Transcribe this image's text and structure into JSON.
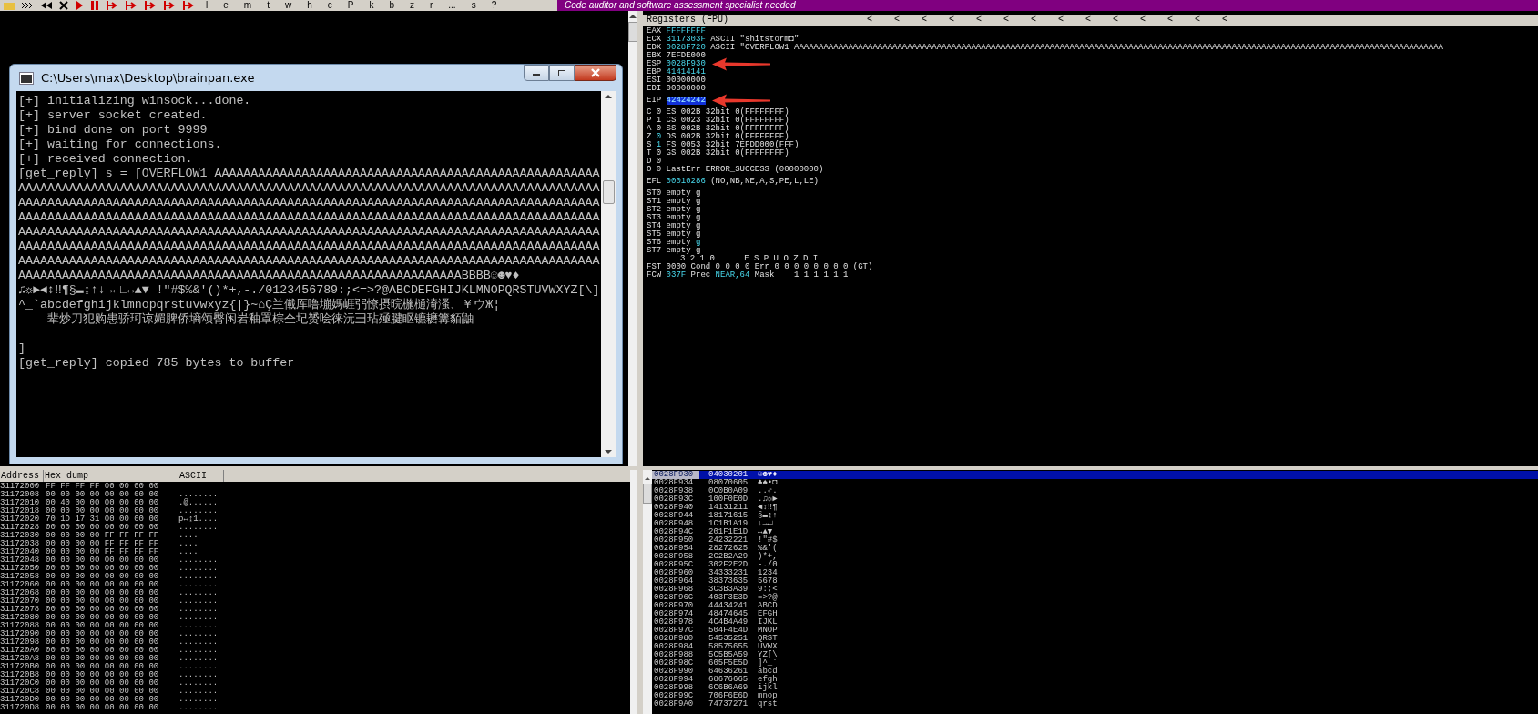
{
  "toolbar": {
    "letters": [
      "l",
      "e",
      "m",
      "t",
      "w",
      "h",
      "c",
      "P",
      "k",
      "b",
      "z",
      "r",
      "...",
      "s",
      "?"
    ],
    "banner": "Code auditor and software assessment specialist needed"
  },
  "console": {
    "title": "C:\\Users\\max\\Desktop\\brainpan.exe",
    "output": [
      [
        "[+] initializing winsock...done.",
        "[+] server socket created.",
        "[+] bind done on port 9999",
        "[+] waiting for connections.",
        "[+] received connection.",
        "[get_reply] s = [OVERFLOW1 AAAAAAAAAAAAAAAAAAAAAAAAAAAAAAAAAAAAAAAAAAAAAAAAAAAAA",
        "AAAAAAAAAAAAAAAAAAAAAAAAAAAAAAAAAAAAAAAAAAAAAAAAAAAAAAAAAAAAAAAAAAAAAAAAAAAAAAAA",
        "AAAAAAAAAAAAAAAAAAAAAAAAAAAAAAAAAAAAAAAAAAAAAAAAAAAAAAAAAAAAAAAAAAAAAAAAAAAAAAAA",
        "AAAAAAAAAAAAAAAAAAAAAAAAAAAAAAAAAAAAAAAAAAAAAAAAAAAAAAAAAAAAAAAAAAAAAAAAAAAAAAAA",
        "AAAAAAAAAAAAAAAAAAAAAAAAAAAAAAAAAAAAAAAAAAAAAAAAAAAAAAAAAAAAAAAAAAAAAAAAAAAAAAAA",
        "AAAAAAAAAAAAAAAAAAAAAAAAAAAAAAAAAAAAAAAAAAAAAAAAAAAAAAAAAAAAAAAAAAAAAAAAAAAAAAAA",
        "AAAAAAAAAAAAAAAAAAAAAAAAAAAAAAAAAAAAAAAAAAAAAAAAAAAAAAAAAAAAAAAAAAAAAAAAAAAAAAAA",
        "AAAAAAAAAAAAAAAAAAAAAAAAAAAAAAAAAAAAAAAAAAAAAAAAAAAAAAAAAAAAABBBB☺☻♥♦",
        "♫☼►◄↕‼¶§▬↨↑↓→←∟↔▲▼ !\"#$%&'()*+,-./0123456789:;<=>?@ABCDEFGHIJKLMNOPQRSTUVWXYZ[\\]",
        "^_`abcdefghijklmnopqrstuvwxyz{|}~⌂Ç兰儎厍噜塴媽崕弜憭摂晥椸樋渏溞、￥ウЖ¦",
        "    辈炒刀犯购患骄珂谅媚脾侨墒颂臀闲岩釉罩棕仝圮赟哙徕沅彐玷殛腱眍镳耱篝貊鼬"
      ],
      [
        "]",
        "[get_reply] copied 785 bytes to buffer"
      ]
    ]
  },
  "registers": {
    "title": "Registers (FPU)",
    "scroll_arrows": [
      "<",
      "<",
      "<",
      "<",
      "<",
      "<",
      "<",
      "<",
      "<",
      "<",
      "<",
      "<",
      "<",
      "<"
    ],
    "lines": [
      {
        "kind": "line",
        "arrow": false,
        "cells": [
          {
            "text": "EAX",
            "kind": "label"
          },
          {
            "text": "FFFFFFFF",
            "kind": "changed"
          }
        ]
      },
      {
        "kind": "line",
        "arrow": false,
        "cells": [
          {
            "text": "ECX",
            "kind": "label"
          },
          {
            "text": "3117303F",
            "kind": "changed"
          },
          {
            "text": "ASCII \"shitstorm◘\"",
            "kind": "label"
          }
        ]
      },
      {
        "kind": "line",
        "arrow": false,
        "cells": [
          {
            "text": "EDX",
            "kind": "label"
          },
          {
            "text": "0028F720",
            "kind": "changed"
          },
          {
            "text": "ASCII \"OVERFLOW1 AAAAAAAAAAAAAAAAAAAAAAAAAAAAAAAAAAAAAAAAAAAAAAAAAAAAAAAAAAAAAAAAAAAAAAAAAAAAAAAAAAAAAAAAAAAAAAAAAAAAAAAAAAAAAAAAAAAAAAAAAAAAAAAAAAAA",
            "kind": "label"
          }
        ]
      },
      {
        "kind": "line",
        "arrow": false,
        "cells": [
          {
            "text": "EBX",
            "kind": "label"
          },
          {
            "text": "7EFDE000",
            "kind": "label"
          }
        ]
      },
      {
        "kind": "line",
        "arrow": true,
        "cells": [
          {
            "text": "ESP",
            "kind": "label"
          },
          {
            "text": "0028F930",
            "kind": "changed"
          }
        ]
      },
      {
        "kind": "line",
        "arrow": false,
        "cells": [
          {
            "text": "EBP",
            "kind": "label"
          },
          {
            "text": "41414141",
            "kind": "changed"
          }
        ]
      },
      {
        "kind": "line",
        "arrow": false,
        "cells": [
          {
            "text": "ESI",
            "kind": "label"
          },
          {
            "text": "00000000",
            "kind": "label"
          }
        ]
      },
      {
        "kind": "line",
        "arrow": false,
        "cells": [
          {
            "text": "EDI",
            "kind": "label"
          },
          {
            "text": "00000000",
            "kind": "label"
          }
        ]
      },
      {
        "kind": "gap"
      },
      {
        "kind": "line",
        "arrow": true,
        "cells": [
          {
            "text": "EIP",
            "kind": "label"
          },
          {
            "text": "42424242",
            "kind": "selected"
          }
        ]
      },
      {
        "kind": "gap"
      },
      {
        "kind": "line",
        "arrow": false,
        "cells": [
          {
            "text": "C",
            "kind": "label"
          },
          {
            "text": "0",
            "kind": "label"
          },
          {
            "text": "ES 002B 32bit 0(FFFFFFFF)",
            "kind": "label"
          }
        ]
      },
      {
        "kind": "line",
        "arrow": false,
        "cells": [
          {
            "text": "P",
            "kind": "label"
          },
          {
            "text": "1",
            "kind": "label"
          },
          {
            "text": "CS 0023 32bit 0(FFFFFFFF)",
            "kind": "label"
          }
        ]
      },
      {
        "kind": "line",
        "arrow": false,
        "cells": [
          {
            "text": "A",
            "kind": "label"
          },
          {
            "text": "0",
            "kind": "label"
          },
          {
            "text": "SS 002B 32bit 0(FFFFFFFF)",
            "kind": "label"
          }
        ]
      },
      {
        "kind": "line",
        "arrow": false,
        "cells": [
          {
            "text": "Z",
            "kind": "label"
          },
          {
            "text": "0",
            "kind": "changed"
          },
          {
            "text": "DS 002B 32bit 0(FFFFFFFF)",
            "kind": "label"
          }
        ]
      },
      {
        "kind": "line",
        "arrow": false,
        "cells": [
          {
            "text": "S",
            "kind": "label"
          },
          {
            "text": "1",
            "kind": "changed"
          },
          {
            "text": "FS 0053 32bit 7EFDD000(FFF)",
            "kind": "label"
          }
        ]
      },
      {
        "kind": "line",
        "arrow": false,
        "cells": [
          {
            "text": "T",
            "kind": "label"
          },
          {
            "text": "0",
            "kind": "label"
          },
          {
            "text": "GS 002B 32bit 0(FFFFFFFF)",
            "kind": "label"
          }
        ]
      },
      {
        "kind": "line",
        "arrow": false,
        "cells": [
          {
            "text": "D",
            "kind": "label"
          },
          {
            "text": "0",
            "kind": "label"
          }
        ]
      },
      {
        "kind": "line",
        "arrow": false,
        "cells": [
          {
            "text": "O",
            "kind": "label"
          },
          {
            "text": "0",
            "kind": "label"
          },
          {
            "text": "LastErr ERROR_SUCCESS (00000000)",
            "kind": "label"
          }
        ]
      },
      {
        "kind": "gap"
      },
      {
        "kind": "line",
        "arrow": false,
        "cells": [
          {
            "text": "EFL",
            "kind": "label"
          },
          {
            "text": "00010286",
            "kind": "changed"
          },
          {
            "text": "(NO,NB,NE,A,S,PE,L,LE)",
            "kind": "label"
          }
        ]
      },
      {
        "kind": "gap"
      },
      {
        "kind": "line",
        "arrow": false,
        "cells": [
          {
            "text": "ST0",
            "kind": "label"
          },
          {
            "text": "empty",
            "kind": "label"
          },
          {
            "text": "g",
            "kind": "label"
          }
        ]
      },
      {
        "kind": "line",
        "arrow": false,
        "cells": [
          {
            "text": "ST1",
            "kind": "label"
          },
          {
            "text": "empty",
            "kind": "label"
          },
          {
            "text": "g",
            "kind": "label"
          }
        ]
      },
      {
        "kind": "line",
        "arrow": false,
        "cells": [
          {
            "text": "ST2",
            "kind": "label"
          },
          {
            "text": "empty",
            "kind": "label"
          },
          {
            "text": "g",
            "kind": "label"
          }
        ]
      },
      {
        "kind": "line",
        "arrow": false,
        "cells": [
          {
            "text": "ST3",
            "kind": "label"
          },
          {
            "text": "empty",
            "kind": "label"
          },
          {
            "text": "g",
            "kind": "label"
          }
        ]
      },
      {
        "kind": "line",
        "arrow": false,
        "cells": [
          {
            "text": "ST4",
            "kind": "label"
          },
          {
            "text": "empty",
            "kind": "label"
          },
          {
            "text": "g",
            "kind": "label"
          }
        ]
      },
      {
        "kind": "line",
        "arrow": false,
        "cells": [
          {
            "text": "ST5",
            "kind": "label"
          },
          {
            "text": "empty",
            "kind": "label"
          },
          {
            "text": "g",
            "kind": "label"
          }
        ]
      },
      {
        "kind": "line",
        "arrow": false,
        "cells": [
          {
            "text": "ST6",
            "kind": "label"
          },
          {
            "text": "empty",
            "kind": "label"
          },
          {
            "text": "g",
            "kind": "changed"
          }
        ]
      },
      {
        "kind": "line",
        "arrow": false,
        "cells": [
          {
            "text": "ST7",
            "kind": "label"
          },
          {
            "text": "empty",
            "kind": "label"
          },
          {
            "text": "g",
            "kind": "label"
          }
        ]
      },
      {
        "kind": "indent",
        "arrow": false,
        "cells": [
          {
            "text": "3 2 1 0      E S P U O Z D I",
            "kind": "label"
          }
        ]
      },
      {
        "kind": "line",
        "arrow": false,
        "cells": [
          {
            "text": "FST",
            "kind": "label"
          },
          {
            "text": "0000",
            "kind": "label"
          },
          {
            "text": "Cond 0 0 0 0",
            "kind": "label"
          },
          {
            "text": "Err 0 0 0 0 0 0 0 0",
            "kind": "label"
          },
          {
            "text": "(GT)",
            "kind": "label"
          }
        ]
      },
      {
        "kind": "line",
        "arrow": false,
        "cells": [
          {
            "text": "FCW",
            "kind": "label"
          },
          {
            "text": "037F",
            "kind": "changed"
          },
          {
            "text": "Prec",
            "kind": "label"
          },
          {
            "text": "NEAR,64",
            "kind": "changed"
          },
          {
            "text": "Mask    1 1 1 1 1 1",
            "kind": "label"
          }
        ]
      }
    ]
  },
  "dump": {
    "columns": [
      "Address",
      "Hex dump",
      "ASCII"
    ],
    "rows": [
      {
        "address": "31172000",
        "hex": "FF FF FF FF 00 00 00 00"
      },
      {
        "address": "31172008",
        "hex": "00 00 00 00 00 00 00 00",
        "ascii": "........"
      },
      {
        "address": "31172010",
        "hex": "00 40 00 00 00 00 00 00",
        "ascii": ".@......"
      },
      {
        "address": "31172018",
        "hex": "00 00 00 00 00 00 00 00",
        "ascii": "........"
      },
      {
        "address": "31172020",
        "hex": "70 1D 17 31 00 00 00 00",
        "ascii": "p↔↨1...."
      },
      {
        "address": "31172028",
        "hex": "00 00 00 00 00 00 00 00",
        "ascii": "........"
      },
      {
        "address": "31172030",
        "hex": "00 00 00 00 FF FF FF FF",
        "ascii": "...."
      },
      {
        "address": "31172038",
        "hex": "00 00 00 00 FF FF FF FF",
        "ascii": "...."
      },
      {
        "address": "31172040",
        "hex": "00 00 00 00 FF FF FF FF",
        "ascii": "...."
      },
      {
        "address": "31172048",
        "hex": "00 00 00 00 00 00 00 00",
        "ascii": "........"
      },
      {
        "address": "31172050",
        "hex": "00 00 00 00 00 00 00 00",
        "ascii": "........"
      },
      {
        "address": "31172058",
        "hex": "00 00 00 00 00 00 00 00",
        "ascii": "........"
      },
      {
        "address": "31172060",
        "hex": "00 00 00 00 00 00 00 00",
        "ascii": "........"
      },
      {
        "address": "31172068",
        "hex": "00 00 00 00 00 00 00 00",
        "ascii": "........"
      },
      {
        "address": "31172070",
        "hex": "00 00 00 00 00 00 00 00",
        "ascii": "........"
      },
      {
        "address": "31172078",
        "hex": "00 00 00 00 00 00 00 00",
        "ascii": "........"
      },
      {
        "address": "31172080",
        "hex": "00 00 00 00 00 00 00 00",
        "ascii": "........"
      },
      {
        "address": "31172088",
        "hex": "00 00 00 00 00 00 00 00",
        "ascii": "........"
      },
      {
        "address": "31172090",
        "hex": "00 00 00 00 00 00 00 00",
        "ascii": "........"
      },
      {
        "address": "31172098",
        "hex": "00 00 00 00 00 00 00 00",
        "ascii": "........"
      },
      {
        "address": "311720A0",
        "hex": "00 00 00 00 00 00 00 00",
        "ascii": "........"
      },
      {
        "address": "311720A8",
        "hex": "00 00 00 00 00 00 00 00",
        "ascii": "........"
      },
      {
        "address": "311720B0",
        "hex": "00 00 00 00 00 00 00 00",
        "ascii": "........"
      },
      {
        "address": "311720B8",
        "hex": "00 00 00 00 00 00 00 00",
        "ascii": "........"
      },
      {
        "address": "311720C0",
        "hex": "00 00 00 00 00 00 00 00",
        "ascii": "........"
      },
      {
        "address": "311720C8",
        "hex": "00 00 00 00 00 00 00 00",
        "ascii": "........"
      },
      {
        "address": "311720D0",
        "hex": "00 00 00 00 00 00 00 00",
        "ascii": "........"
      },
      {
        "address": "311720D8",
        "hex": "00 00 00 00 00 00 00 00",
        "ascii": "........"
      }
    ]
  },
  "stack": {
    "rows": [
      {
        "address": "0028F930",
        "value": "04030201",
        "ascii": "☺☻♥♦",
        "selected": true
      },
      {
        "address": "0028F934",
        "value": "08070605",
        "ascii": "♣♠•◘",
        "selected": false
      },
      {
        "address": "0028F938",
        "value": "0C0B0A09",
        "ascii": "..♂.",
        "selected": false
      },
      {
        "address": "0028F93C",
        "value": "100F0E0D",
        "ascii": ".♫☼►",
        "selected": false
      },
      {
        "address": "0028F940",
        "value": "14131211",
        "ascii": "◄↕‼¶",
        "selected": false
      },
      {
        "address": "0028F944",
        "value": "18171615",
        "ascii": "§▬↨↑",
        "selected": false
      },
      {
        "address": "0028F948",
        "value": "1C1B1A19",
        "ascii": "↓→←∟",
        "selected": false
      },
      {
        "address": "0028F94C",
        "value": "201F1E1D",
        "ascii": "↔▲▼",
        "selected": false
      },
      {
        "address": "0028F950",
        "value": "24232221",
        "ascii": "!\"#$",
        "selected": false
      },
      {
        "address": "0028F954",
        "value": "28272625",
        "ascii": "%&'(",
        "selected": false
      },
      {
        "address": "0028F958",
        "value": "2C2B2A29",
        "ascii": ")*+,",
        "selected": false
      },
      {
        "address": "0028F95C",
        "value": "302F2E2D",
        "ascii": "-./0",
        "selected": false
      },
      {
        "address": "0028F960",
        "value": "34333231",
        "ascii": "1234",
        "selected": false
      },
      {
        "address": "0028F964",
        "value": "38373635",
        "ascii": "5678",
        "selected": false
      },
      {
        "address": "0028F968",
        "value": "3C3B3A39",
        "ascii": "9:;<",
        "selected": false
      },
      {
        "address": "0028F96C",
        "value": "403F3E3D",
        "ascii": "=>?@",
        "selected": false
      },
      {
        "address": "0028F970",
        "value": "44434241",
        "ascii": "ABCD",
        "selected": false
      },
      {
        "address": "0028F974",
        "value": "48474645",
        "ascii": "EFGH",
        "selected": false
      },
      {
        "address": "0028F978",
        "value": "4C4B4A49",
        "ascii": "IJKL",
        "selected": false
      },
      {
        "address": "0028F97C",
        "value": "504F4E4D",
        "ascii": "MNOP",
        "selected": false
      },
      {
        "address": "0028F980",
        "value": "54535251",
        "ascii": "QRST",
        "selected": false
      },
      {
        "address": "0028F984",
        "value": "58575655",
        "ascii": "UVWX",
        "selected": false
      },
      {
        "address": "0028F988",
        "value": "5C5B5A59",
        "ascii": "YZ[\\",
        "selected": false
      },
      {
        "address": "0028F98C",
        "value": "605F5E5D",
        "ascii": "]^_`",
        "selected": false
      },
      {
        "address": "0028F990",
        "value": "64636261",
        "ascii": "abcd",
        "selected": false
      },
      {
        "address": "0028F994",
        "value": "68676665",
        "ascii": "efgh",
        "selected": false
      },
      {
        "address": "0028F998",
        "value": "6C6B6A69",
        "ascii": "ijkl",
        "selected": false
      },
      {
        "address": "0028F99C",
        "value": "706F6E6D",
        "ascii": "mnop",
        "selected": false
      },
      {
        "address": "0028F9A0",
        "value": "74737271",
        "ascii": "qrst",
        "selected": false
      }
    ]
  }
}
